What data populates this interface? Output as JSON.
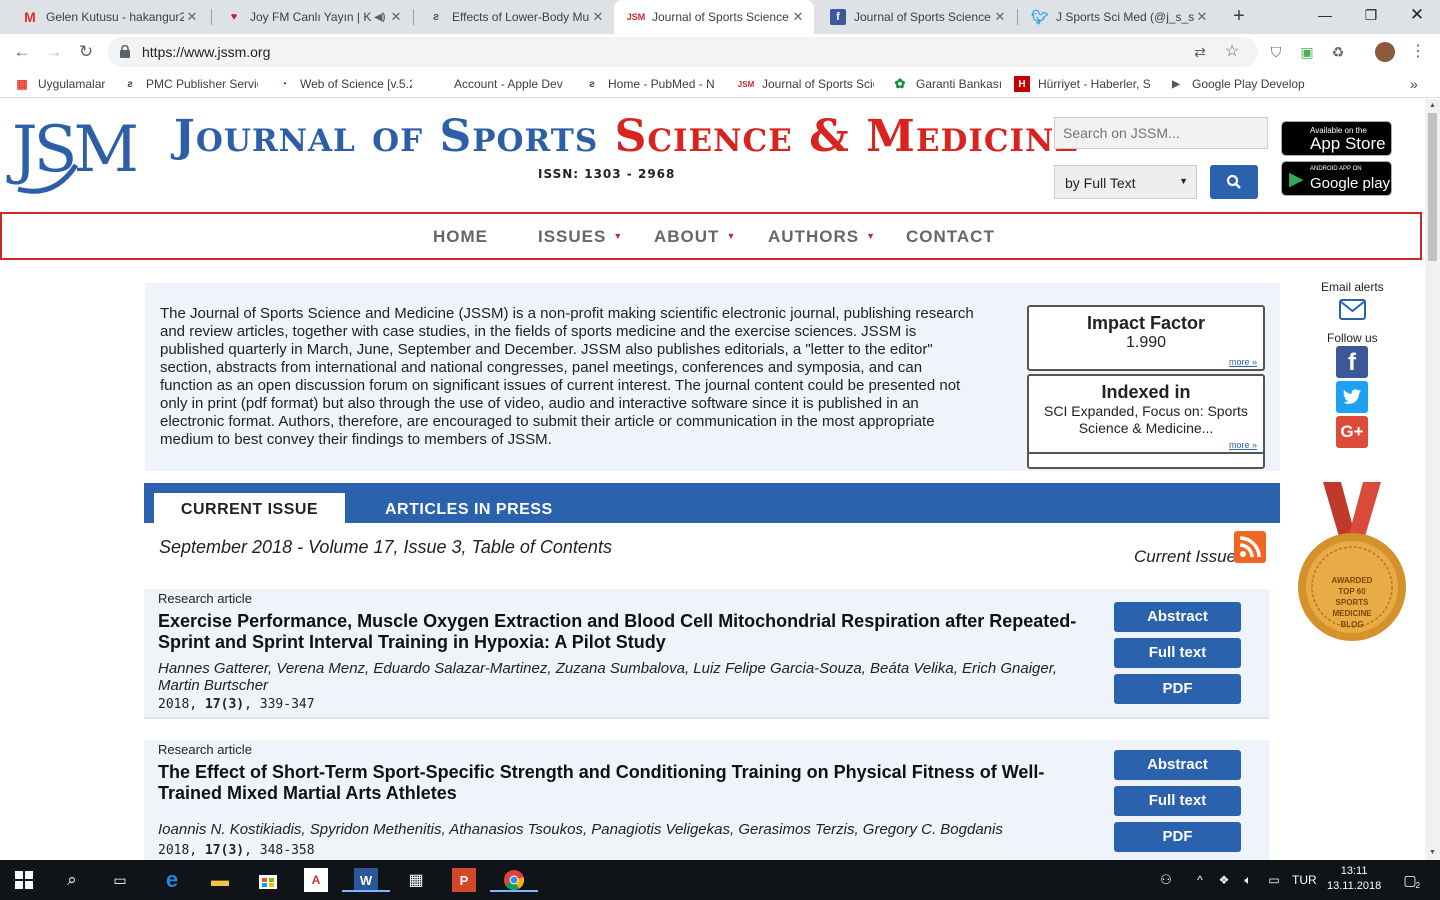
{
  "browser": {
    "tabs": [
      {
        "title": "Gelen Kutusu - hakangur2",
        "icon": "gmail-icon"
      },
      {
        "title": "Joy FM Canlı Yayın | K",
        "icon": "joyfm-icon",
        "audio": true
      },
      {
        "title": "Effects of Lower-Body Mu",
        "icon": "pubmed-icon"
      },
      {
        "title": "Journal of Sports Science",
        "icon": "jssm-icon",
        "active": true
      },
      {
        "title": "Journal of Sports Science",
        "icon": "facebook-icon"
      },
      {
        "title": "J Sports Sci Med (@j_s_s_",
        "icon": "twitter-icon"
      }
    ],
    "url": "https://www.jssm.org",
    "bookmarks": [
      {
        "label": "Uygulamalar",
        "icon": "apps-grid-icon"
      },
      {
        "label": "PMC Publisher Servic",
        "icon": "pmc-icon"
      },
      {
        "label": "Web of Science [v.5.2",
        "icon": "wos-icon"
      },
      {
        "label": "Account - Apple Dev",
        "icon": "apple-icon"
      },
      {
        "label": "Home - PubMed - N",
        "icon": "pubmed-icon"
      },
      {
        "label": "Journal of Sports Scie",
        "icon": "jssm-icon"
      },
      {
        "label": "Garanti Bankası",
        "icon": "garanti-icon"
      },
      {
        "label": "Hürriyet - Haberler, S",
        "icon": "hurriyet-icon"
      },
      {
        "label": "Google Play Develop",
        "icon": "google-play-icon"
      }
    ]
  },
  "site": {
    "logo_text": "JSM",
    "title_parts": [
      "Journal of ",
      "Sports ",
      "Science & Medicine"
    ],
    "issn": "ISSN: 1303 - 2968",
    "search_placeholder": "Search on JSSM...",
    "search_scope": "by Full Text",
    "app_store": {
      "small": "Available on the",
      "big": "App Store"
    },
    "google_play": {
      "small": "ANDROID APP ON",
      "big": "Google play"
    },
    "nav": [
      {
        "label": "HOME",
        "dropdown": false
      },
      {
        "label": "ISSUES",
        "dropdown": true
      },
      {
        "label": "ABOUT",
        "dropdown": true
      },
      {
        "label": "AUTHORS",
        "dropdown": true
      },
      {
        "label": "CONTACT",
        "dropdown": false
      }
    ]
  },
  "about": {
    "text": "The Journal of Sports Science and Medicine (JSSM) is a non-profit making scientific electronic journal, publishing research and review articles, together with case studies, in the fields of sports medicine and the exercise sciences. JSSM is published quarterly in March, June, September and December. JSSM also publishes editorials, a \"letter to the editor\" section, abstracts from international and national congresses, panel meetings, conferences and symposia, and can function as an open discussion forum on significant issues of current interest. The journal content could be presented not only in print (pdf format) but also through the use of video, audio and interactive software since it is published in an electronic format. Authors, therefore, are encouraged to submit their article or communication in the most appropriate medium to best convey their findings to members of JSSM.",
    "impact_factor": {
      "title": "Impact Factor",
      "value": "1.990",
      "more": "more »"
    },
    "indexed_in": {
      "title": "Indexed in",
      "value": "SCI Expanded, Focus on: Sports Science & Medicine...",
      "more": "more »"
    }
  },
  "issue_tabs": {
    "current": "CURRENT ISSUE",
    "press": "ARTICLES IN PRESS"
  },
  "toc": {
    "heading": "September 2018 - Volume 17, Issue 3, Table of Contents",
    "current_issue_label": "Current Issue"
  },
  "articles": [
    {
      "type": "Research article",
      "title": "Exercise Performance, Muscle Oxygen Extraction and Blood Cell Mitochondrial Respiration after Repeated-Sprint and Sprint Interval Training in Hypoxia: A Pilot Study",
      "authors": "Hannes Gatterer, Verena Menz, Eduardo Salazar-Martinez, Zuzana Sumbalova, Luiz Felipe Garcia-Souza, Beáta Velika, Erich Gnaiger, Martin Burtscher",
      "year": "2018, ",
      "volume": "17(3)",
      "pages": ", 339-347",
      "buttons": [
        "Abstract",
        "Full text",
        "PDF"
      ]
    },
    {
      "type": "Research article",
      "title": "The Effect of Short-Term Sport-Specific Strength and Conditioning Training on Physical Fitness of Well-Trained Mixed Martial Arts Athletes",
      "authors": "Ioannis N. Kostikiadis, Spyridon Methenitis, Athanasios Tsoukos, Panagiotis Veligekas, Gerasimos Terzis, Gregory C. Bogdanis",
      "year": "2018, ",
      "volume": "17(3)",
      "pages": ", 348-358",
      "buttons": [
        "Abstract",
        "Full text",
        "PDF"
      ]
    }
  ],
  "rail": {
    "email_label": "Email alerts",
    "follow_label": "Follow us",
    "badge_lines": [
      "AWARDED",
      "TOP 60",
      "SPORTS",
      "MEDICINE",
      "BLOG"
    ]
  },
  "taskbar": {
    "lang": "TUR",
    "time": "13:11",
    "date": "13.11.2018",
    "notifications": "2"
  },
  "colors": {
    "brand_blue": "#2b62ad",
    "brand_red": "#d9231f",
    "panel_bg": "#eef4fa",
    "rss_orange": "#f26522"
  }
}
